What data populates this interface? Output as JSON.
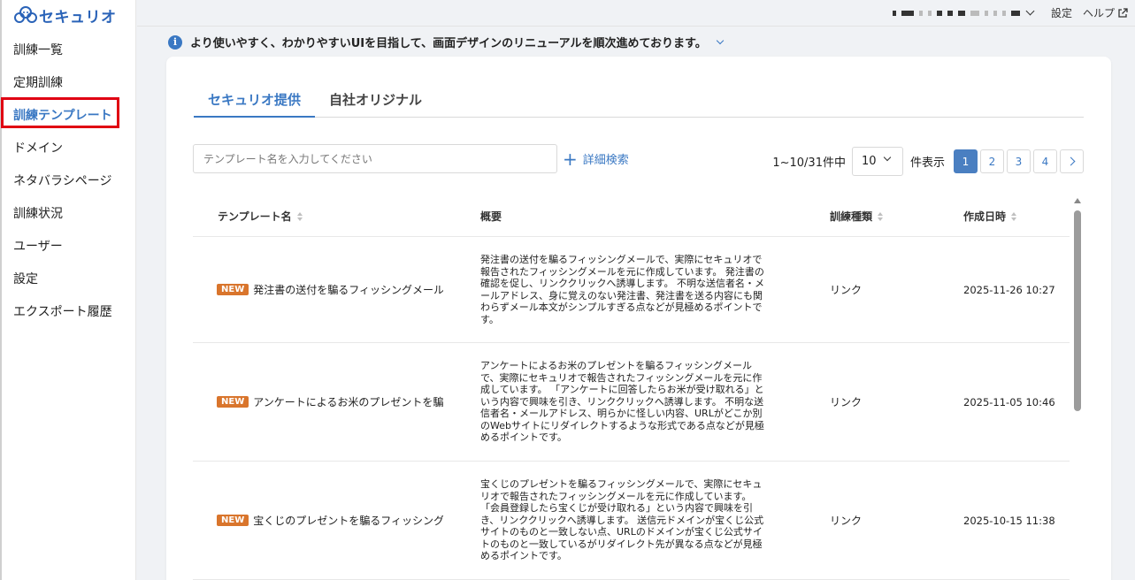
{
  "app": {
    "name": "セキュリオ"
  },
  "sidebar": {
    "items": [
      {
        "label": "訓練一覧"
      },
      {
        "label": "定期訓練"
      },
      {
        "label": "訓練テンプレート"
      },
      {
        "label": "ドメイン"
      },
      {
        "label": "ネタバラシページ"
      },
      {
        "label": "訓練状況"
      },
      {
        "label": "ユーザー"
      },
      {
        "label": "設定"
      },
      {
        "label": "エクスポート履歴"
      }
    ],
    "active_index": 2
  },
  "topbar": {
    "settings_label": "設定",
    "help_label": "ヘルプ"
  },
  "notice": {
    "text": "より使いやすく、わかりやすいUIを目指して、画面デザインのリニューアルを順次進めております。"
  },
  "tabs": [
    {
      "label": "セキュリオ提供",
      "active": true
    },
    {
      "label": "自社オリジナル",
      "active": false
    }
  ],
  "search": {
    "placeholder": "テンプレート名を入力してください",
    "value": ""
  },
  "advanced_search_label": "詳細検索",
  "pagination": {
    "range_text": "1~10/31件中",
    "per_page": "10",
    "unit_text": "件表示",
    "pages": [
      "1",
      "2",
      "3",
      "4"
    ],
    "current_page": "1"
  },
  "table": {
    "headers": [
      "テンプレート名",
      "概要",
      "訓練種類",
      "作成日時"
    ],
    "rows": [
      {
        "badge": "NEW",
        "name": "発注書の送付を騙るフィッシングメール",
        "summary": "発注書の送付を騙るフィッシングメールで、実際にセキュリオで報告されたフィッシングメールを元に作成しています。 発注書の確認を促し、リンククリックへ誘導します。 不明な送信者名・メールアドレス、身に覚えのない発注書、発注書を送る内容にも関わらずメール本文がシンプルすぎる点などが見極めるポイントです。",
        "type": "リンク",
        "created": "2025-11-26 10:27"
      },
      {
        "badge": "NEW",
        "name": "アンケートによるお米のプレゼントを騙るフィッシングメール",
        "summary": "アンケートによるお米のプレゼントを騙るフィッシングメールで、実際にセキュリオで報告されたフィッシングメールを元に作成しています。 「アンケートに回答したらお米が受け取れる」という内容で興味を引き、リンククリックへ誘導します。 不明な送信者名・メールアドレス、明らかに怪しい内容、URLがどこか別のWebサイトにリダイレクトするような形式である点などが見極めるポイントです。",
        "type": "リンク",
        "created": "2025-11-05 10:46"
      },
      {
        "badge": "NEW",
        "name": "宝くじのプレゼントを騙るフィッシングメール",
        "summary": "宝くじのプレゼントを騙るフィッシングメールで、実際にセキュリオで報告されたフィッシングメールを元に作成しています。 「会員登録したら宝くじが受け取れる」という内容で興味を引き、リンククリックへ誘導します。 送信元ドメインが宝くじ公式サイトのものと一致しない点、URLのドメインが宝くじ公式サイトのものと一致しているがリダイレクト先が異なる点などが見極めるポイントです。",
        "type": "リンク",
        "created": "2025-10-15 11:38"
      }
    ]
  },
  "colors": {
    "accent": "#3a78c3",
    "badge": "#d9752c",
    "highlight": "#e00012"
  }
}
